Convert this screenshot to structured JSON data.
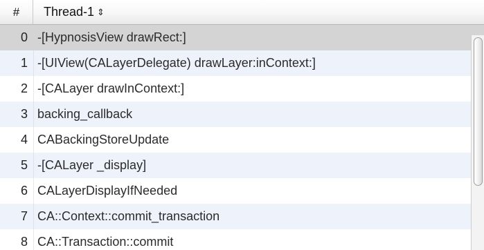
{
  "table": {
    "column_index_label": "#",
    "column_thread_label": "Thread-1",
    "sort_icon": "up-down-arrow-icon",
    "rows": [
      {
        "index": "0",
        "label": "-[HypnosisView drawRect:]"
      },
      {
        "index": "1",
        "label": "-[UIView(CALayerDelegate) drawLayer:inContext:]"
      },
      {
        "index": "2",
        "label": "-[CALayer drawInContext:]"
      },
      {
        "index": "3",
        "label": "backing_callback"
      },
      {
        "index": "4",
        "label": "CABackingStoreUpdate"
      },
      {
        "index": "5",
        "label": "-[CALayer _display]"
      },
      {
        "index": "6",
        "label": "CALayerDisplayIfNeeded"
      },
      {
        "index": "7",
        "label": "CA::Context::commit_transaction"
      },
      {
        "index": "8",
        "label": "CA::Transaction::commit"
      }
    ]
  }
}
